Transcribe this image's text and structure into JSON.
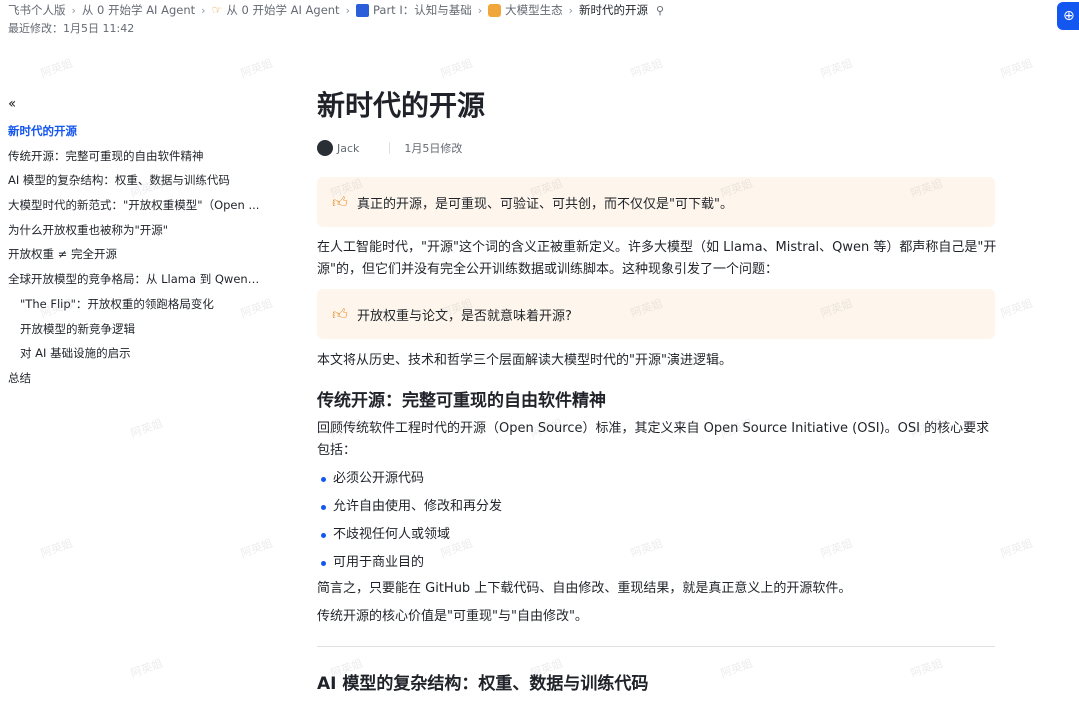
{
  "header": {
    "breadcrumb": [
      {
        "label": "飞书个人版",
        "icon": ""
      },
      {
        "label": "从 0 开始学 AI Agent",
        "icon": ""
      },
      {
        "label": "从 0 开始学 AI  Agent",
        "icon": "hand-icon"
      },
      {
        "label": "Part Ⅰ：认知与基础",
        "icon": "part-icon"
      },
      {
        "label": "大模型生态",
        "icon": "eco-icon"
      },
      {
        "label": "新时代的开源",
        "icon": ""
      }
    ],
    "last_edited": "最近修改：1月5日 11:42"
  },
  "outline": {
    "items": [
      {
        "label": "新时代的开源",
        "level": 1,
        "active": true
      },
      {
        "label": "传统开源：完整可重现的自由软件精神",
        "level": 1,
        "active": false
      },
      {
        "label": "AI 模型的复杂结构：权重、数据与训练代码",
        "level": 1,
        "active": false
      },
      {
        "label": "大模型时代的新范式：\"开放权重模型\"（Open ...",
        "level": 1,
        "active": false
      },
      {
        "label": "为什么开放权重也被称为\"开源\"",
        "level": 1,
        "active": false
      },
      {
        "label": "开放权重 ≠ 完全开源",
        "level": 1,
        "active": false
      },
      {
        "label": "全球开放模型的竞争格局：从 Llama 到 Qwen ...",
        "level": 1,
        "active": false
      },
      {
        "label": "\"The Flip\"：开放权重的领跑格局变化",
        "level": 2,
        "active": false
      },
      {
        "label": "开放模型的新竞争逻辑",
        "level": 2,
        "active": false
      },
      {
        "label": "对 AI 基础设施的启示",
        "level": 2,
        "active": false
      },
      {
        "label": "总结",
        "level": 1,
        "active": false
      }
    ]
  },
  "doc": {
    "title": "新时代的开源",
    "author": "Jack",
    "modified": "1月5日修改",
    "callout_1": "真正的开源，是可重现、可验证、可共创，而不仅仅是\"可下载\"。",
    "intro": "在人工智能时代，\"开源\"这个词的含义正被重新定义。许多大模型（如 Llama、Mistral、Qwen 等）都声称自己是\"开源\"的，但它们并没有完全公开训练数据或训练脚本。这种现象引发了一个问题：",
    "callout_2": "开放权重与论文，是否就意味着开源?",
    "summary": "本文将从历史、技术和哲学三个层面解读大模型时代的\"开源\"演进逻辑。",
    "section_1_title": "传统开源：完整可重现的自由软件精神",
    "section_1_para": "回顾传统软件工程时代的开源（Open Source）标准，其定义来自 Open Source Initiative (OSI)。OSI 的核心要求包括：",
    "bullets": [
      "必须公开源代码",
      "允许自由使用、修改和再分发",
      "不歧视任何人或领域",
      "可用于商业目的"
    ],
    "simple": "简言之，只要能在 GitHub 上下载代码、自由修改、重现结果，就是真正意义上的开源软件。",
    "core": "传统开源的核心价值是\"可重现\"与\"自由修改\"。",
    "section_2_title": "AI 模型的复杂结构：权重、数据与训练代码"
  },
  "watermark_text": "阿英姐",
  "colors": {
    "accent": "#1456f0",
    "callout_bg": "#fef6ec",
    "thumb": "#e8953a"
  }
}
